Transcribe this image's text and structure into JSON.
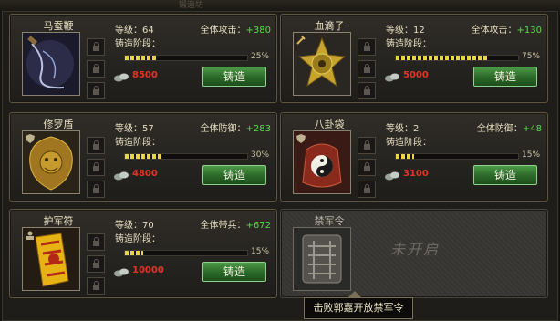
{
  "window": {
    "title": "锻造坊"
  },
  "labels": {
    "level_prefix": "等级：",
    "stage": "铸造阶段：",
    "forge_button": "铸造"
  },
  "items": [
    {
      "name": "马蚕鞭",
      "level": "64",
      "stat_label": "全体攻击：",
      "stat_bonus": "+380",
      "progress_pct": "25%",
      "progress": 0.25,
      "cost": "8500",
      "icon": "whip-icon"
    },
    {
      "name": "血滴子",
      "level": "12",
      "stat_label": "全体攻击：",
      "stat_bonus": "+130",
      "progress_pct": "75%",
      "progress": 0.75,
      "cost": "5000",
      "icon": "bloodtrap-icon"
    },
    {
      "name": "修罗盾",
      "level": "57",
      "stat_label": "全体防御：",
      "stat_bonus": "+283",
      "progress_pct": "30%",
      "progress": 0.3,
      "cost": "4800",
      "icon": "shield-icon"
    },
    {
      "name": "八卦袋",
      "level": "2",
      "stat_label": "全体防御：",
      "stat_bonus": "+48",
      "progress_pct": "15%",
      "progress": 0.15,
      "cost": "3100",
      "icon": "bagua-bag-icon"
    },
    {
      "name": "护军符",
      "level": "70",
      "stat_label": "全体带兵：",
      "stat_bonus": "+672",
      "progress_pct": "15%",
      "progress": 0.15,
      "cost": "10000",
      "icon": "talisman-icon"
    }
  ],
  "locked_item": {
    "name": "禁军令",
    "status": "未开启",
    "tooltip": "击败郭嘉开放禁军令"
  },
  "colors": {
    "bonus": "#5bd94e",
    "cost": "#e2352a",
    "progress": "#e8d54a",
    "button": "#3a7f36"
  }
}
